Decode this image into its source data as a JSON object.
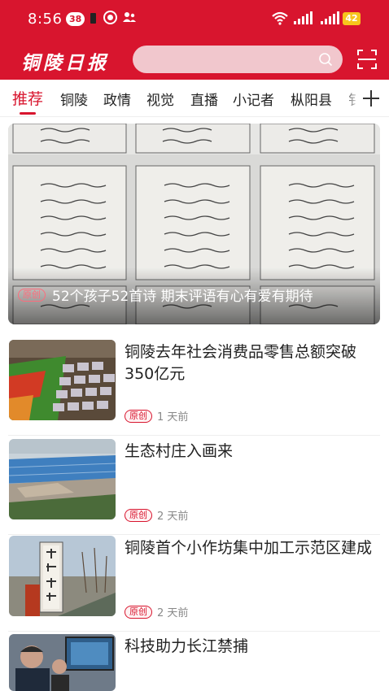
{
  "status_bar": {
    "time": "8:56",
    "notification_count": "38",
    "battery_level": "42"
  },
  "header": {
    "app_logo_text": "铜陵日报",
    "search_placeholder": "",
    "brand_color": "#d8152e"
  },
  "tabs": [
    {
      "label": "推荐",
      "active": true
    },
    {
      "label": "铜陵"
    },
    {
      "label": "政情"
    },
    {
      "label": "视觉"
    },
    {
      "label": "直播"
    },
    {
      "label": "小记者"
    },
    {
      "label": "枞阳县"
    },
    {
      "label": "钅"
    }
  ],
  "feature": {
    "tag": "原创",
    "title": "52个孩子52首诗 期末评语有心有爱有期待"
  },
  "news": [
    {
      "title": "铜陵去年社会消费品零售总额突破350亿元",
      "tag": "原创",
      "time": "1 天前"
    },
    {
      "title": "生态村庄入画来",
      "tag": "原创",
      "time": "2 天前"
    },
    {
      "title": "铜陵首个小作坊集中加工示范区建成",
      "tag": "原创",
      "time": "2 天前"
    },
    {
      "title": "科技助力长江禁捕",
      "tag": "",
      "time": ""
    }
  ]
}
